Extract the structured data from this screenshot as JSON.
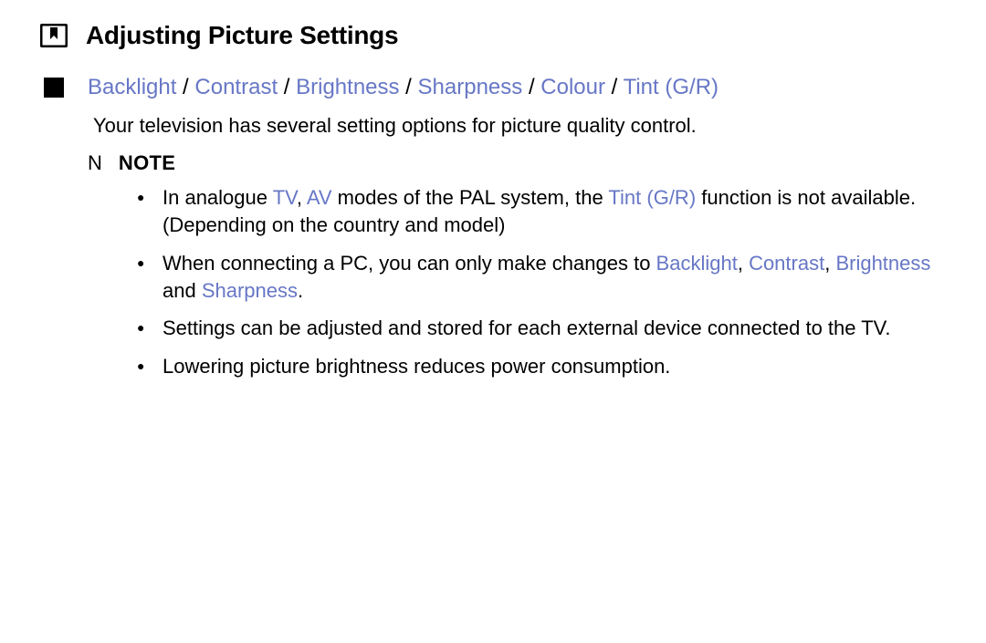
{
  "title": "Adjusting Picture Settings",
  "section": {
    "heading_parts": [
      "Backlight",
      "Contrast",
      "Brightness",
      "Sharpness",
      "Colour",
      "Tint (G/R)"
    ],
    "separator": " / ",
    "intro": "Your television has several setting options for picture quality control."
  },
  "note": {
    "marker": "N",
    "label": "NOTE",
    "items": [
      {
        "segments": [
          {
            "t": "In analogue "
          },
          {
            "t": "TV",
            "accent": true
          },
          {
            "t": ", "
          },
          {
            "t": "AV",
            "accent": true
          },
          {
            "t": " modes of the PAL system, the "
          },
          {
            "t": "Tint (G/R)",
            "accent": true
          },
          {
            "t": " function is not available. (Depending on the country and model)"
          }
        ]
      },
      {
        "segments": [
          {
            "t": "When connecting a PC, you can only make changes to "
          },
          {
            "t": "Backlight",
            "accent": true
          },
          {
            "t": ", "
          },
          {
            "t": "Contrast",
            "accent": true
          },
          {
            "t": ", "
          },
          {
            "t": "Brightness",
            "accent": true
          },
          {
            "t": " and "
          },
          {
            "t": "Sharpness",
            "accent": true
          },
          {
            "t": "."
          }
        ]
      },
      {
        "segments": [
          {
            "t": "Settings can be adjusted and stored for each external device connected to the TV."
          }
        ]
      },
      {
        "segments": [
          {
            "t": "Lowering picture brightness reduces power consumption."
          }
        ]
      }
    ]
  }
}
